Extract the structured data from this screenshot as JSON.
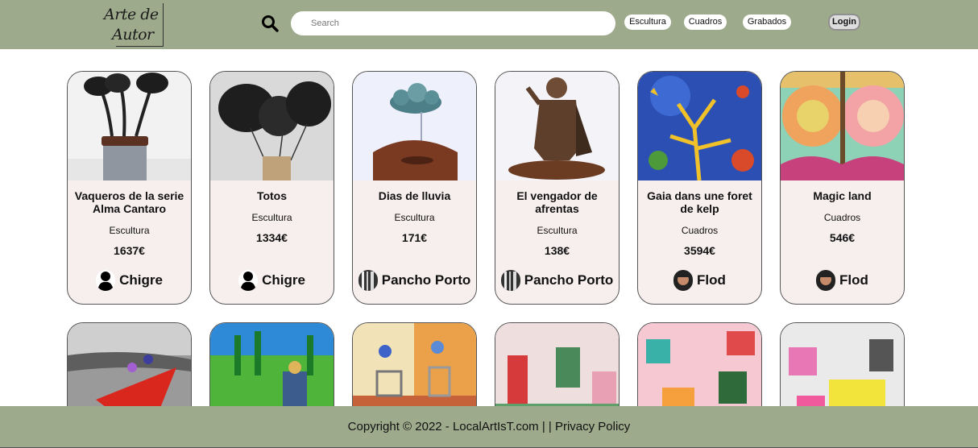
{
  "header": {
    "logo_line1": "Arte de",
    "logo_line2": "Autor",
    "search_placeholder": "Search",
    "nav": [
      "Escultura",
      "Cuadros",
      "Grabados"
    ],
    "login_label": "Login",
    "color": "#9eaa8c"
  },
  "products": [
    {
      "title": "Vaqueros de la serie Alma Cantaro",
      "category": "Escultura",
      "price": "1637€",
      "artist": "Chigre"
    },
    {
      "title": "Totos",
      "category": "Escultura",
      "price": "1334€",
      "artist": "Chigre"
    },
    {
      "title": "Dias de lluvia",
      "category": "Escultura",
      "price": "171€",
      "artist": "Pancho Porto"
    },
    {
      "title": "El vengador de afrentas",
      "category": "Escultura",
      "price": "138€",
      "artist": "Pancho Porto"
    },
    {
      "title": "Gaia dans une foret de kelp",
      "category": "Cuadros",
      "price": "3594€",
      "artist": "Flod"
    },
    {
      "title": "Magic land",
      "category": "Cuadros",
      "price": "546€",
      "artist": "Flod"
    }
  ],
  "footer": {
    "text": "Copyright © 2022 - LocalArtIsT.com | | Privacy Policy"
  }
}
